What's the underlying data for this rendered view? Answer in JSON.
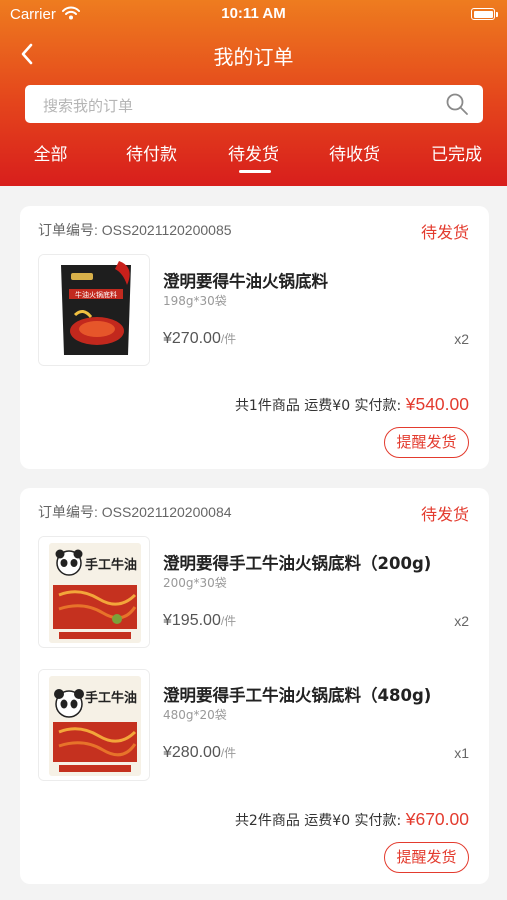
{
  "status_bar": {
    "carrier": "Carrier",
    "time": "10:11 AM"
  },
  "nav": {
    "title": "我的订单"
  },
  "search": {
    "placeholder": "搜索我的订单"
  },
  "tabs": [
    {
      "label": "全部"
    },
    {
      "label": "待付款"
    },
    {
      "label": "待发货",
      "active": true
    },
    {
      "label": "待收货"
    },
    {
      "label": "已完成"
    }
  ],
  "colors": {
    "accent": "#e33b2e",
    "header_top": "#ee7c1f",
    "header_bottom": "#d81e1c"
  },
  "orders": [
    {
      "order_no": "订单编号: OSS2021120200085",
      "status": "待发货",
      "items": [
        {
          "name": "澄明要得牛油火锅底料",
          "spec": "198g*30袋",
          "price": "¥270.00",
          "unit": "/件",
          "qty": "x2",
          "image_icon": "hotpot-package-black",
          "image_text": {
            "top": "牛油火锅底料"
          }
        }
      ],
      "summary": {
        "text": "共1件商品 运费¥0 实付款: ",
        "amount": "¥540.00"
      },
      "action": "提醒发货"
    },
    {
      "order_no": "订单编号: OSS2021120200084",
      "status": "待发货",
      "items": [
        {
          "name": "澄明要得手工牛油火锅底料（200g)",
          "spec": "200g*30袋",
          "price": "¥195.00",
          "unit": "/件",
          "qty": "x2",
          "image_icon": "hotpot-package-panda",
          "image_text": {
            "title": "手工牛油"
          }
        },
        {
          "name": "澄明要得手工牛油火锅底料（480g)",
          "spec": "480g*20袋",
          "price": "¥280.00",
          "unit": "/件",
          "qty": "x1",
          "image_icon": "hotpot-package-panda",
          "image_text": {
            "title": "手工牛油"
          }
        }
      ],
      "summary": {
        "text": "共2件商品 运费¥0 实付款: ",
        "amount": "¥670.00"
      },
      "action": "提醒发货"
    }
  ]
}
